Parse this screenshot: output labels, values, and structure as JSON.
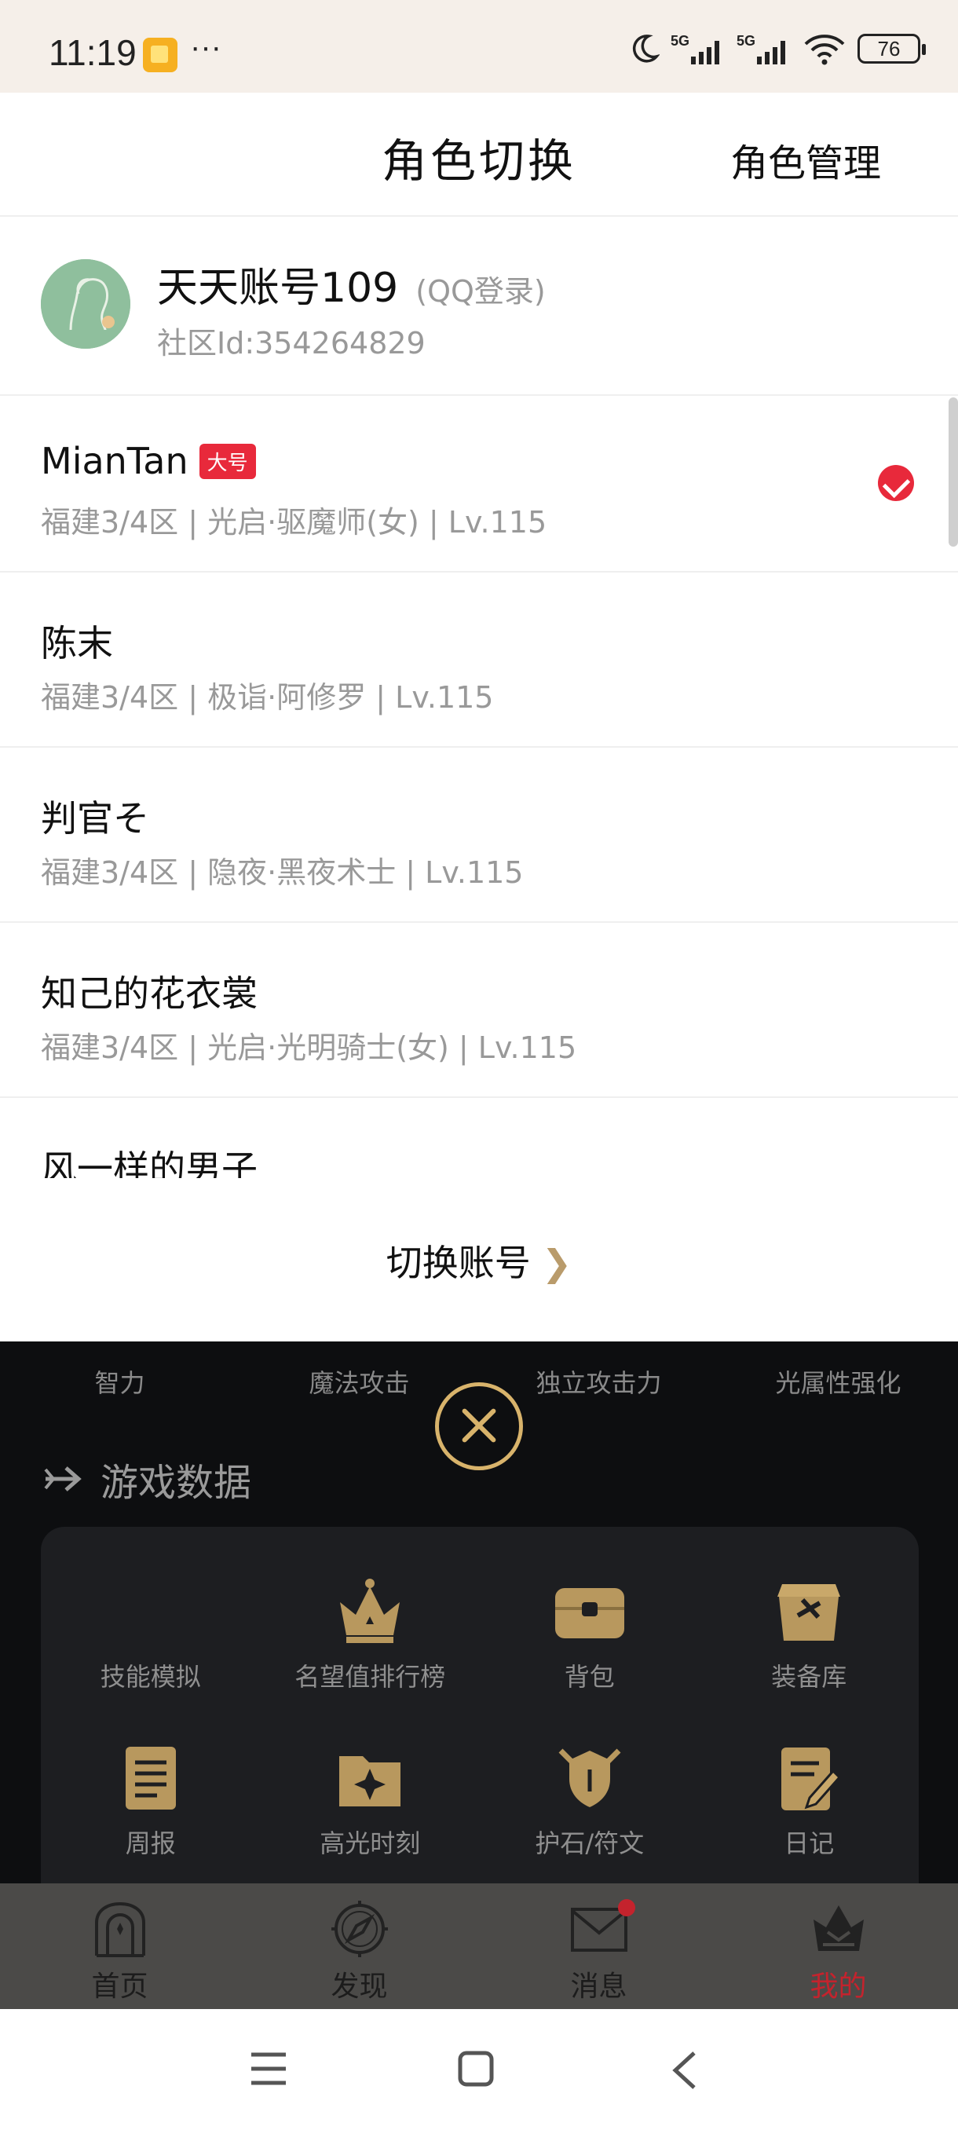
{
  "status_bar": {
    "time": "11:19",
    "dots": "···",
    "battery": "76"
  },
  "sheet": {
    "title": "角色切换",
    "manage_label": "角色管理"
  },
  "account": {
    "name": "天天账号109",
    "login": "(QQ登录)",
    "id_text": "社区Id:354264829"
  },
  "roles": [
    {
      "name": "MianTan",
      "badge": "大号",
      "info": "福建3/4区 | 光启·驱魔师(女) | Lv.115",
      "selected": true
    },
    {
      "name": "陈末",
      "badge": "",
      "info": "福建3/4区 | 极诣·阿修罗 | Lv.115",
      "selected": false
    },
    {
      "name": "判官そ",
      "badge": "",
      "info": "福建3/4区 | 隐夜·黑夜术士 | Lv.115",
      "selected": false
    },
    {
      "name": "知己的花衣裳",
      "badge": "",
      "info": "福建3/4区 | 光启·光明骑士(女) | Lv.115",
      "selected": false
    },
    {
      "name": "风一样的男子",
      "badge": "",
      "info": "",
      "selected": false
    }
  ],
  "switch_account": {
    "label": "切换账号",
    "chevron": "❯"
  },
  "background": {
    "stats": [
      "智力",
      "魔法攻击",
      "独立攻击力",
      "光属性强化"
    ],
    "section_title": "游戏数据",
    "grid": [
      {
        "label": "技能模拟",
        "icon": "skill-icon"
      },
      {
        "label": "名望值排行榜",
        "icon": "crown-icon"
      },
      {
        "label": "背包",
        "icon": "bag-icon"
      },
      {
        "label": "装备库",
        "icon": "chest-icon"
      },
      {
        "label": "周报",
        "icon": "scroll-icon"
      },
      {
        "label": "高光时刻",
        "icon": "highlight-icon"
      },
      {
        "label": "护石/符文",
        "icon": "rune-icon"
      },
      {
        "label": "日记",
        "icon": "diary-icon"
      }
    ]
  },
  "bottom_nav": [
    {
      "label": "首页",
      "icon": "home-gate-icon",
      "active": false
    },
    {
      "label": "发现",
      "icon": "compass-icon",
      "active": false
    },
    {
      "label": "消息",
      "icon": "mail-icon",
      "active": false
    },
    {
      "label": "我的",
      "icon": "crown-helmet-icon",
      "active": true
    }
  ],
  "colors": {
    "accent_red": "#e8293b",
    "gold": "#d8b36b"
  }
}
